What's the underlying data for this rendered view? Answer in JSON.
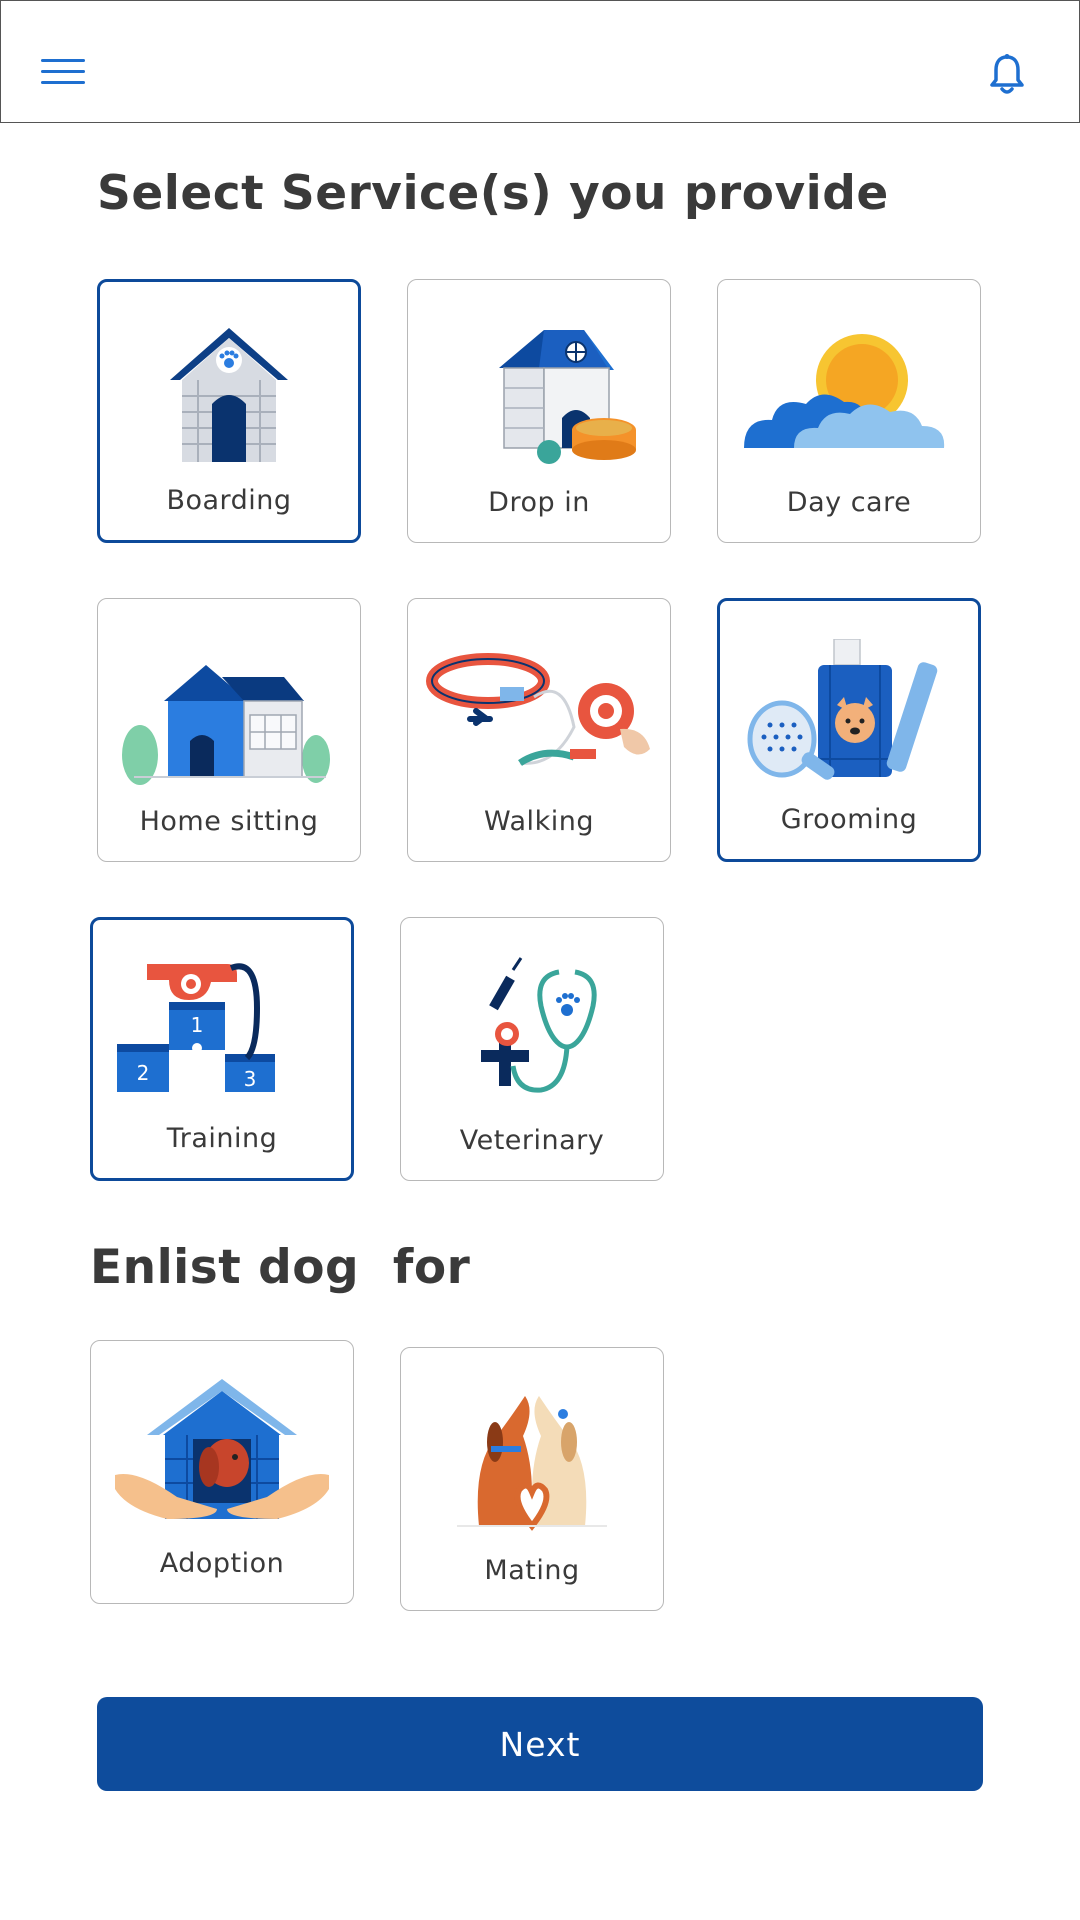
{
  "header": {
    "menu_icon": "hamburger-menu-icon",
    "notification_icon": "bell-icon"
  },
  "services": {
    "title": "Select Service(s) you provide",
    "items": [
      {
        "label": "Boarding",
        "icon": "dog-house-icon",
        "selected": true
      },
      {
        "label": "Drop in",
        "icon": "kennel-food-bowl-icon",
        "selected": false
      },
      {
        "label": "Day care",
        "icon": "sun-clouds-icon",
        "selected": false
      },
      {
        "label": "Home sitting",
        "icon": "house-icon",
        "selected": false
      },
      {
        "label": "Walking",
        "icon": "collar-leash-icon",
        "selected": false
      },
      {
        "label": "Grooming",
        "icon": "grooming-kit-icon",
        "selected": true
      },
      {
        "label": "Training",
        "icon": "whistle-podium-icon",
        "selected": true
      },
      {
        "label": "Veterinary",
        "icon": "stethoscope-icon",
        "selected": false
      }
    ]
  },
  "enlist": {
    "title": "Enlist dog  for",
    "items": [
      {
        "label": "Adoption",
        "icon": "hands-dog-house-icon",
        "selected": false
      },
      {
        "label": "Mating",
        "icon": "two-dogs-heart-icon",
        "selected": false
      }
    ]
  },
  "footer": {
    "next_label": "Next"
  },
  "colors": {
    "primary": "#0e4c9c",
    "accent": "#1e6fd0",
    "text": "#3a3a3a",
    "card_border": "#b8b8b8"
  }
}
